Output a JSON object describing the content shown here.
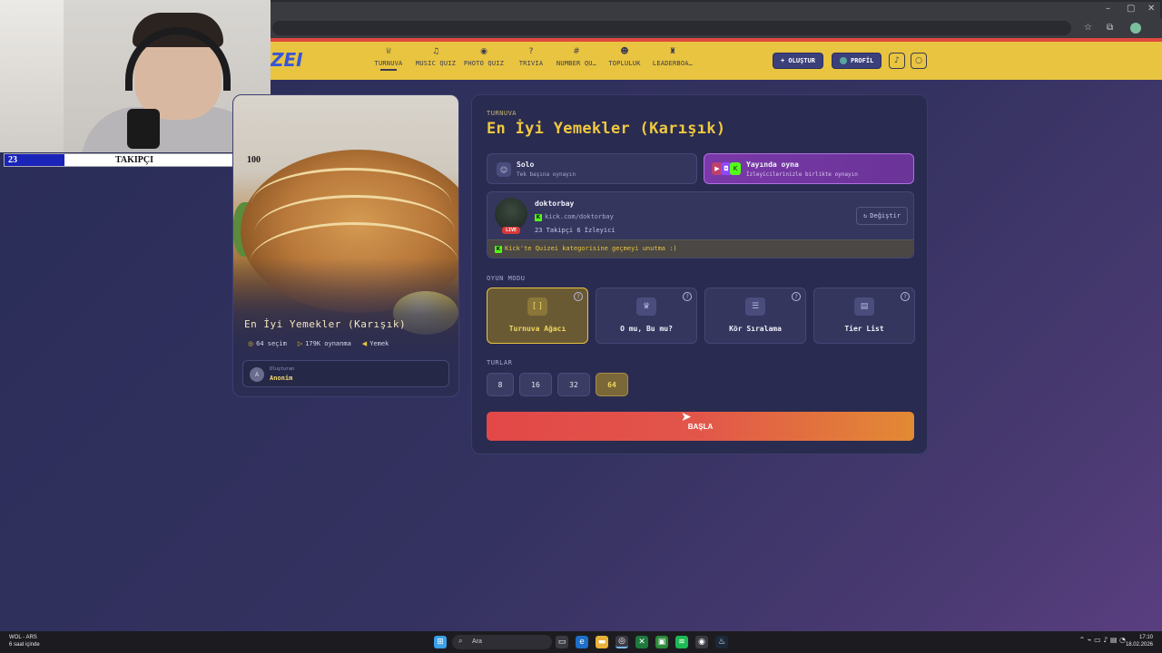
{
  "browser": {
    "win_controls": [
      "–",
      "▢",
      "✕"
    ],
    "addr_icons": [
      "☆",
      "⧉"
    ]
  },
  "site": {
    "logo": "ZEI",
    "nav": [
      {
        "label": "TURNUVA",
        "icon": "trophy-icon",
        "glyph": "♕"
      },
      {
        "label": "MUSIC QUIZ",
        "icon": "music-icon",
        "glyph": "♫"
      },
      {
        "label": "PHOTO QUIZ",
        "icon": "camera-icon",
        "glyph": "◉"
      },
      {
        "label": "TRIVIA",
        "icon": "chat-icon",
        "glyph": "?"
      },
      {
        "label": "NUMBER QU…",
        "icon": "hash-icon",
        "glyph": "#"
      },
      {
        "label": "TOPLULUK",
        "icon": "users-icon",
        "glyph": "☻"
      },
      {
        "label": "LEADERBOA…",
        "icon": "medal-icon",
        "glyph": "♜"
      }
    ],
    "create_label": "+ OLUŞTUR",
    "profile_label": "PROFİL",
    "bell_glyph": "♪",
    "search_glyph": "○"
  },
  "overlay": {
    "follow_current": "23",
    "follow_label": "TAKIPÇI",
    "follow_goal": "100",
    "follow_progress": 0.23
  },
  "quiz_card": {
    "title": "En İyi Yemekler (Karışık)",
    "stats": [
      {
        "icon": "layers-icon",
        "glyph": "◎",
        "text": "64 seçim"
      },
      {
        "icon": "play-icon",
        "glyph": "▷",
        "text": "179K oynanma"
      },
      {
        "icon": "tag-icon",
        "glyph": "◀",
        "text": "Yemek"
      }
    ],
    "creator_label": "Oluşturan",
    "creator_name": "Anonim",
    "creator_initial": "A"
  },
  "panel": {
    "kicker": "TURNUVA",
    "title": "En İyi Yemekler (Karışık)",
    "solo": {
      "name": "Solo",
      "sub": "Tek başına oynayın"
    },
    "stream": {
      "name": "Yayında oyna",
      "sub": "İzleyicilerinizle birlikte oynayın"
    },
    "streamer": {
      "name": "doktorbay",
      "link": "kick.com/doktorbay",
      "stats": "23 Takipçi  6 İzleyici",
      "live": "LIVE",
      "change_label": "Değiştir",
      "note": "Kick'te Quizei kategorisine geçmeyi unutma :)"
    },
    "mode_label": "OYUN MODU",
    "modes": [
      {
        "label": "Turnuva Ağacı",
        "glyph": "[ ]",
        "active": true
      },
      {
        "label": "O mu, Bu mu?",
        "glyph": "♛",
        "active": false
      },
      {
        "label": "Kör Sıralama",
        "glyph": "☰",
        "active": false
      },
      {
        "label": "Tier List",
        "glyph": "▤",
        "active": false
      }
    ],
    "rounds_label": "TURLAR",
    "rounds": [
      "8",
      "16",
      "32",
      "64"
    ],
    "selected_round": "64",
    "start_label": "BAŞLA"
  },
  "taskbar": {
    "weather_title": "WOL - ARS",
    "weather_sub": "6 saat içinde",
    "search_placeholder": "Ara",
    "time": "17:10",
    "date": "18.02.2026"
  },
  "colors": {
    "accent_yellow": "#e8c440",
    "start_red": "#e24848",
    "start_orange": "#e28a34",
    "stream_purple": "#7a38a8",
    "kick_green": "#53fc18",
    "follow_blue": "#1a24b8"
  }
}
